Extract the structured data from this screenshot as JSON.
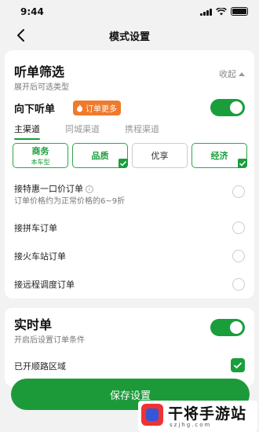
{
  "status": {
    "time": "9:44"
  },
  "nav": {
    "title": "模式设置"
  },
  "listen": {
    "title": "听单筛选",
    "subtitle": "展开后可选类型",
    "collapse_label": "收起",
    "direction_label": "向下听单",
    "badge_label": "订单更多",
    "toggle_on": true
  },
  "tabs": [
    {
      "label": "主渠道",
      "active": true
    },
    {
      "label": "同城渠道",
      "active": false
    },
    {
      "label": "携程渠道",
      "active": false
    }
  ],
  "chips": [
    {
      "label": "商务",
      "sub": "本车型",
      "selected": true,
      "checked": false
    },
    {
      "label": "品质",
      "sub": "",
      "selected": true,
      "checked": true
    },
    {
      "label": "优享",
      "sub": "",
      "selected": false,
      "checked": false
    },
    {
      "label": "经济",
      "sub": "",
      "selected": true,
      "checked": true
    }
  ],
  "options": [
    {
      "label": "接特惠一口价订单",
      "sub": "订单价格约为正常价格的6~9折",
      "info": "i"
    },
    {
      "label": "接拼车订单"
    },
    {
      "label": "接火车站订单"
    },
    {
      "label": "接远程调度订单"
    }
  ],
  "realtime": {
    "title": "实时单",
    "subtitle": "开启后设置订单条件",
    "toggle_on": true,
    "route_label": "已开顺路区域"
  },
  "save_label": "保存设置",
  "watermark": {
    "name": "干将手游站",
    "url": "szjhg.com"
  },
  "colors": {
    "accent": "#1a9e3c",
    "badge": "#f07a2c"
  }
}
